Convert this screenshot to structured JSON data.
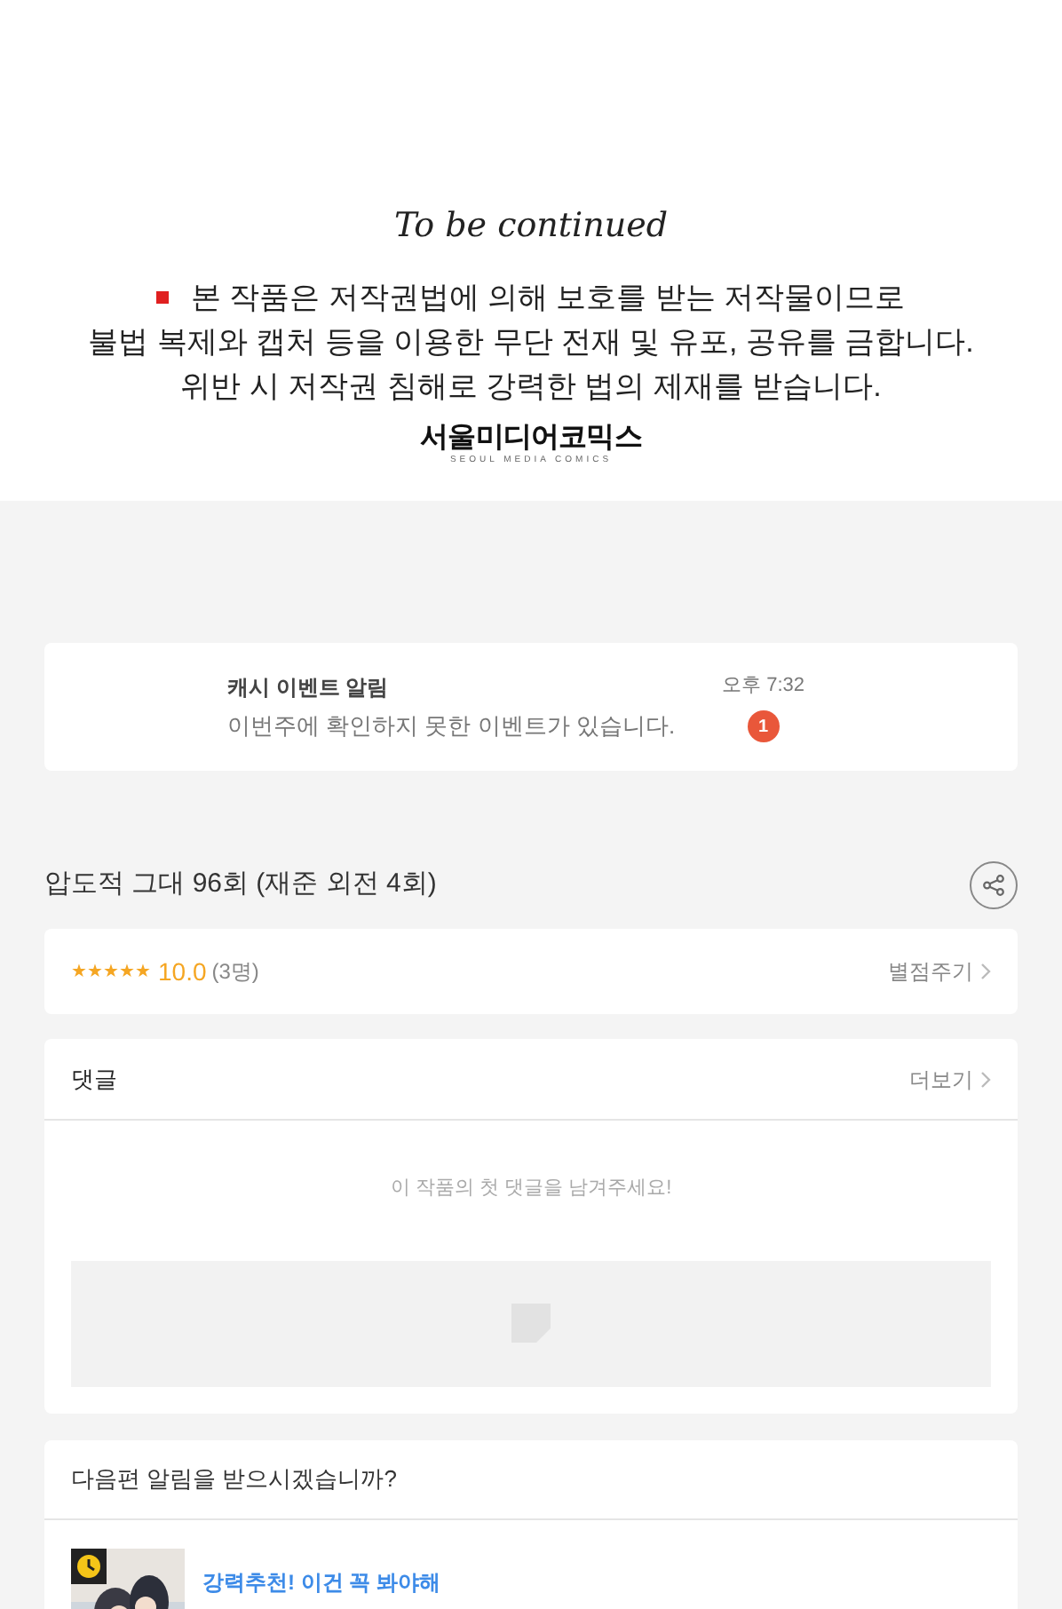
{
  "episode_end": {
    "title": "To be continued",
    "notice": [
      "본 작품은 저작권법에 의해 보호를 받는 저작물이므로",
      "불법 복제와 캡처 등을 이용한 무단 전재 및 유포, 공유를 금합니다.",
      "위반 시 저작권 침해로 강력한 법의 제재를 받습니다."
    ],
    "publisher": "서울미디어코믹스",
    "publisher_sub": "SEOUL MEDIA COMICS"
  },
  "notification": {
    "title": "캐시 이벤트 알림",
    "message": "이번주에 확인하지 못한 이벤트가 있습니다.",
    "time": "오후 7:32",
    "count": "1"
  },
  "episode_title": "압도적 그대 96회 (재준 외전 4회)",
  "rating": {
    "stars": 5,
    "score": "10.0",
    "count": "(3명)",
    "action": "별점주기"
  },
  "comments": {
    "title": "댓글",
    "more": "더보기",
    "empty": "이 작품의 첫 댓글을 남겨주세요!"
  },
  "next_alert": {
    "title": "다음편 알림을 받으시겠습니까?"
  },
  "recommendation": {
    "title": "강력추천! 이건 꼭 봐야해"
  }
}
